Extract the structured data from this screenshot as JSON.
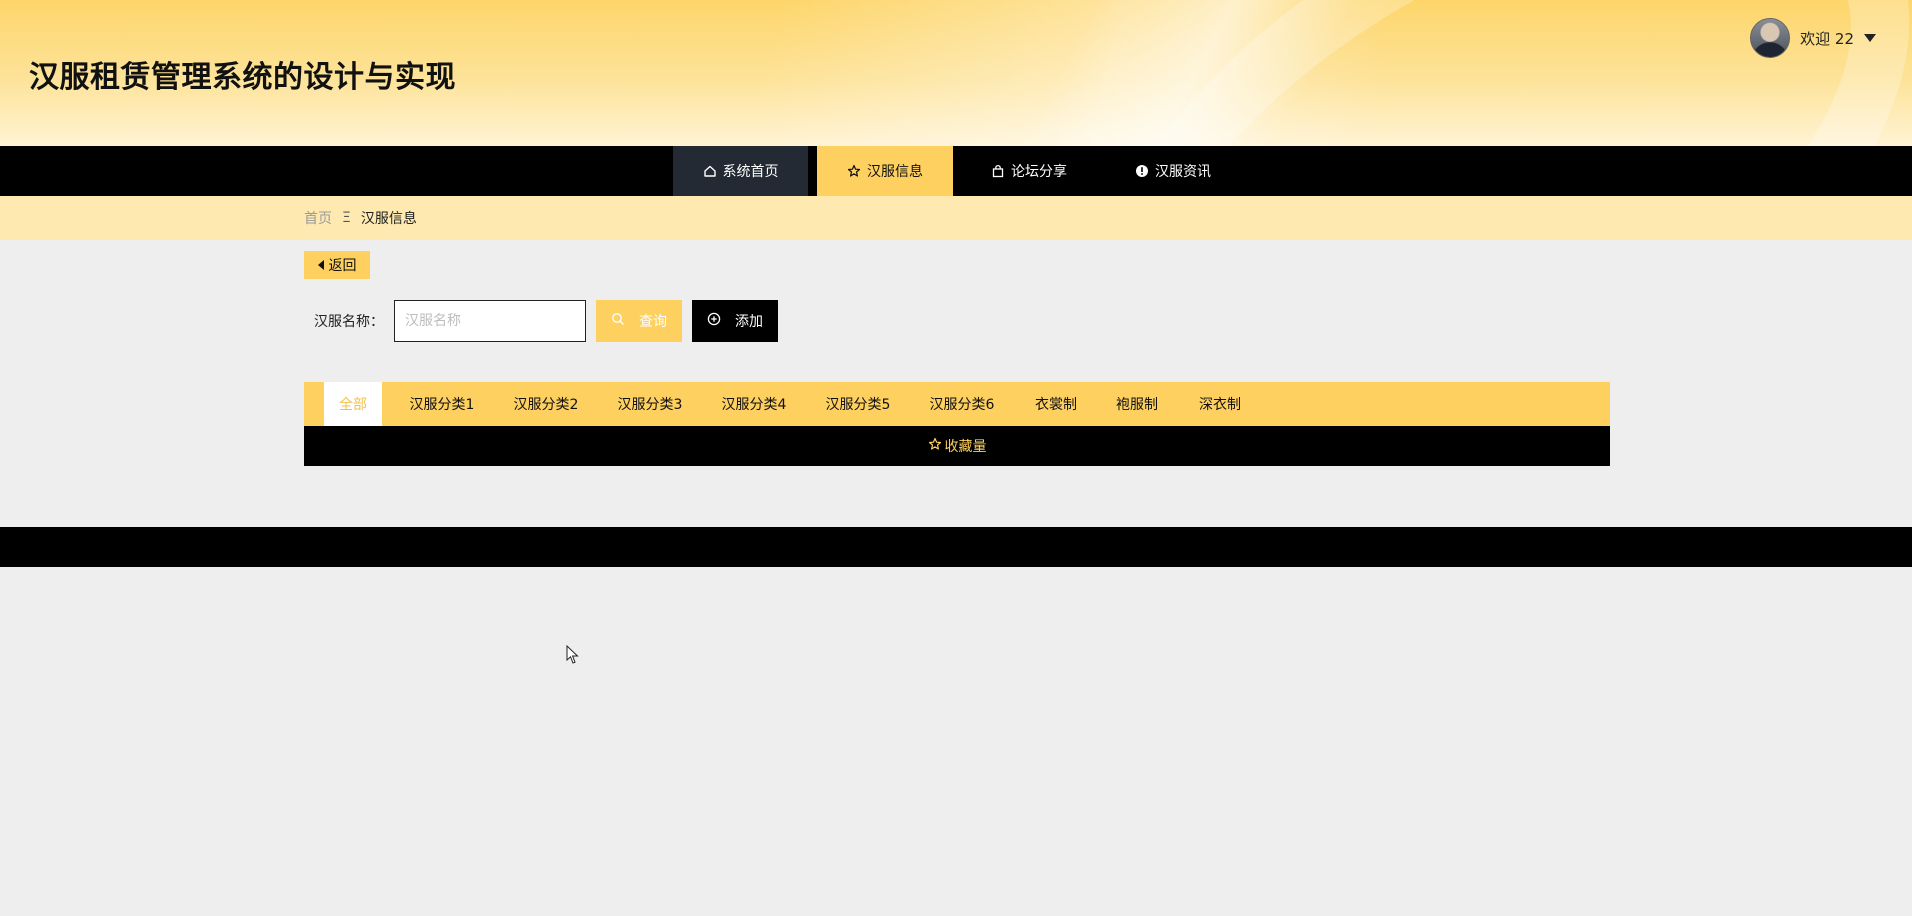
{
  "header": {
    "site_title": "汉服租赁管理系统的设计与实现",
    "welcome": "欢迎 22"
  },
  "nav": {
    "items": [
      {
        "label": "系统首页",
        "icon": "home-icon"
      },
      {
        "label": "汉服信息",
        "icon": "star-icon"
      },
      {
        "label": "论坛分享",
        "icon": "bag-icon"
      },
      {
        "label": "汉服资讯",
        "icon": "info-circle-icon"
      }
    ],
    "active_index": 1
  },
  "breadcrumb": {
    "home": "首页",
    "separator": "Ξ",
    "current": "汉服信息"
  },
  "actions": {
    "back_label": "返回",
    "search_label": "汉服名称：",
    "search_placeholder": "汉服名称",
    "search_value": "",
    "query_label": "查询",
    "add_label": "添加"
  },
  "categories": {
    "items": [
      "全部",
      "汉服分类1",
      "汉服分类2",
      "汉服分类3",
      "汉服分类4",
      "汉服分类5",
      "汉服分类6",
      "衣裳制",
      "袍服制",
      "深衣制"
    ],
    "active_index": 0
  },
  "sort": {
    "label": "收藏量",
    "icon": "star-icon"
  },
  "colors": {
    "accent": "#fdd05f",
    "nav_bg": "#000000",
    "nav_home_bg": "#232a33",
    "crumb_bg": "#feeab1",
    "page_bg": "#eeeeee"
  }
}
